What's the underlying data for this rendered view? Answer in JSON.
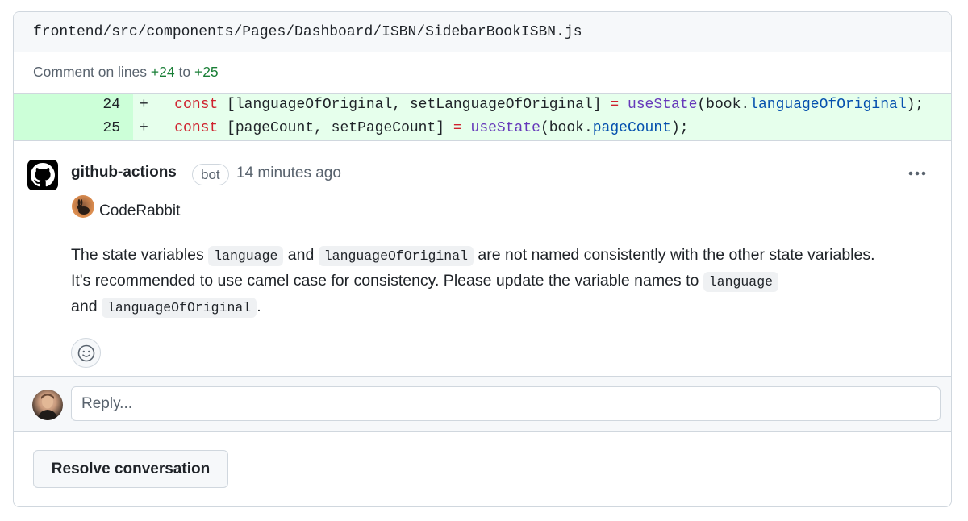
{
  "file": {
    "path": "frontend/src/components/Pages/Dashboard/ISBN/SidebarBookISBN.js"
  },
  "lines_note": {
    "prefix": "Comment on lines",
    "from": "+24",
    "joiner": "to",
    "to": "+25"
  },
  "diff": {
    "rows": [
      {
        "number": "24",
        "marker": "+",
        "tokens": {
          "kw": "const",
          "a": " [languageOfOriginal, setLanguageOfOriginal] ",
          "eq": "=",
          "sp": " ",
          "fn": "useState",
          "b": "(book.",
          "prop": "languageOfOriginal",
          "c": ");"
        }
      },
      {
        "number": "25",
        "marker": "+",
        "tokens": {
          "kw": "const",
          "a": " [pageCount, setPageCount] ",
          "eq": "=",
          "sp": " ",
          "fn": "useState",
          "b": "(book.",
          "prop": "pageCount",
          "c": ");"
        }
      }
    ]
  },
  "comment": {
    "author": "github-actions",
    "badge": "bot",
    "time": "14 minutes ago",
    "menu_icon": "kebab-horizontal-icon",
    "persona": "CodeRabbit",
    "body": {
      "t1": "The state variables ",
      "c1": "language",
      "t2": " and ",
      "c2": "languageOfOriginal",
      "t3": " are not named consistently with the other state variables. It's recommended to use camel case for consistency. Please update the variable names to ",
      "c3": "language",
      "t4": " and ",
      "c4": "languageOfOriginal",
      "t5": "."
    }
  },
  "reply": {
    "placeholder": "Reply..."
  },
  "actions": {
    "resolve_label": "Resolve conversation"
  },
  "colors": {
    "added_line_bg": "#e6ffec",
    "added_num_bg": "#ccffd8",
    "keyword": "#cf222e",
    "function": "#6639ba",
    "property": "#0550ae",
    "line_ref": "#1a7f37"
  }
}
